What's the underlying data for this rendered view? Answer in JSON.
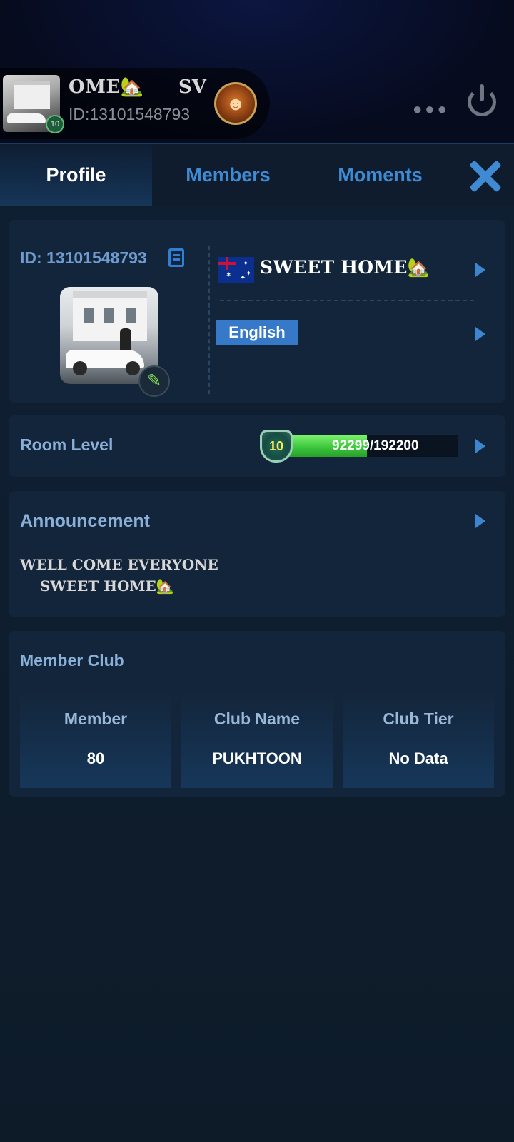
{
  "header": {
    "room_name_part1": "OME🏡",
    "room_name_part2": "SV",
    "room_id": "ID:13101548793",
    "room_level_badge": "10",
    "more_icon": "ellipsis-icon",
    "power_icon": "power-icon"
  },
  "tabs": [
    {
      "label": "Profile",
      "active": true
    },
    {
      "label": "Members",
      "active": false
    },
    {
      "label": "Moments",
      "active": false
    }
  ],
  "profile": {
    "id_label": "ID: 13101548793",
    "room_title": "SWEET HOME🏡",
    "language": "English",
    "country_flag": "australia-flag-icon"
  },
  "room_level": {
    "label": "Room Level",
    "level": "10",
    "progress_text": "92299/192200",
    "current": 92299,
    "max": 192200
  },
  "announcement": {
    "label": "Announcement",
    "text": "WELL COME EVERYONE\n    SWEET HOME🏡"
  },
  "member_club": {
    "label": "Member Club",
    "cells": [
      {
        "label": "Member",
        "value": "80"
      },
      {
        "label": "Club Name",
        "value": "PUKHTOON"
      },
      {
        "label": "Club Tier",
        "value": "No Data"
      }
    ]
  },
  "colors": {
    "accent": "#3f8ad2",
    "progress_green": "#38c23a",
    "language_badge": "#3679c9"
  }
}
